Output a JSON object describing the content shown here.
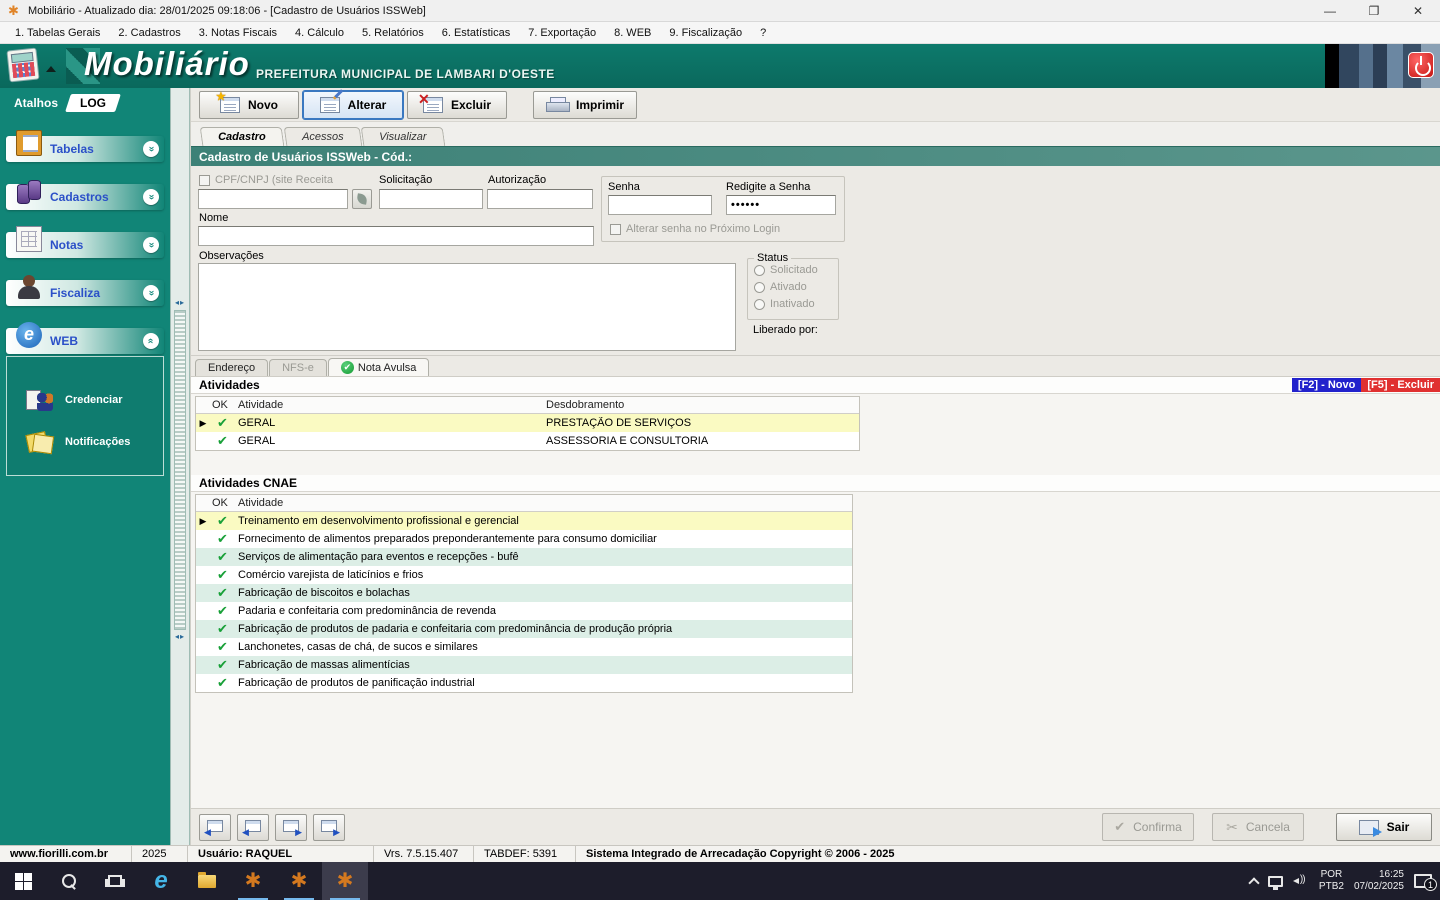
{
  "window": {
    "title": "Mobiliário - Atualizado dia: 28/01/2025 09:18:06 - [Cadastro de Usuários ISSWeb]",
    "menu": [
      "1. Tabelas Gerais",
      "2. Cadastros",
      "3. Notas Fiscais",
      "4. Cálculo",
      "5. Relatórios",
      "6. Estatísticas",
      "7. Exportação",
      "8. WEB",
      "9. Fiscalização",
      "?"
    ]
  },
  "header": {
    "logo": "Mobiliário",
    "subtitle": "PREFEITURA MUNICIPAL DE LAMBARI D'OESTE"
  },
  "sidebar": {
    "shortcuts_label": "Atalhos",
    "log_label": "LOG",
    "groups": [
      {
        "label": "Tabelas"
      },
      {
        "label": "Cadastros"
      },
      {
        "label": "Notas"
      },
      {
        "label": "Fiscaliza"
      },
      {
        "label": "WEB"
      }
    ],
    "web_items": [
      {
        "label": "Credenciar"
      },
      {
        "label": "Notificações"
      }
    ]
  },
  "toolbar": {
    "novo": "Novo",
    "alterar": "Alterar",
    "excluir": "Excluir",
    "imprimir": "Imprimir"
  },
  "tabs": [
    "Cadastro",
    "Acessos",
    "Visualizar"
  ],
  "form": {
    "section_title": "Cadastro de Usuários ISSWeb - Cód.:",
    "cpf_label": "CPF/CNPJ (site Receita",
    "solicitacao_label": "Solicitação",
    "autorizacao_label": "Autorização",
    "senha_label": "Senha",
    "redigite_label": "Redigite a Senha",
    "senha_value": "••••••",
    "alterar_senha_label": "Alterar senha no Próximo Login",
    "nome_label": "Nome",
    "observacoes_label": "Observações",
    "status_label": "Status",
    "status_options": [
      "Solicitado",
      "Ativado",
      "Inativado"
    ],
    "liberado_label": "Liberado por:"
  },
  "subtabs": [
    "Endereço",
    "NFS-e",
    "Nota Avulsa"
  ],
  "atividades": {
    "title": "Atividades",
    "f2_label": "[F2] - Novo",
    "f5_label": "[F5] - Excluir",
    "columns": [
      "OK",
      "Atividade",
      "Desdobramento"
    ],
    "rows": [
      {
        "atividade": "GERAL",
        "desdobramento": "PRESTAÇÃO DE SERVIÇOS"
      },
      {
        "atividade": "GERAL",
        "desdobramento": "ASSESSORIA E CONSULTORIA"
      }
    ]
  },
  "atividades_cnae": {
    "title": "Atividades CNAE",
    "columns": [
      "OK",
      "Atividade"
    ],
    "rows": [
      "Treinamento em desenvolvimento profissional e gerencial",
      "Fornecimento de alimentos preparados preponderantemente para consumo domiciliar",
      "Serviços de alimentação para eventos e recepções - bufê",
      "Comércio varejista de laticínios e frios",
      "Fabricação de biscoitos e bolachas",
      "Padaria e confeitaria com predominância de revenda",
      "Fabricação de produtos de padaria e confeitaria com predominância de produção própria",
      "Lanchonetes, casas de chá, de sucos e similares",
      "Fabricação de massas alimentícias",
      "Fabricação de produtos de panificação industrial"
    ]
  },
  "footer": {
    "confirma": "Confirma",
    "cancela": "Cancela",
    "sair": "Sair"
  },
  "statusbar": {
    "site": "www.fiorilli.com.br",
    "year": "2025",
    "user": "Usuário: RAQUEL",
    "version": "Vrs. 7.5.15.407",
    "tabdef": "TABDEF: 5391",
    "copyright": "Sistema Integrado de Arrecadação Copyright © 2006 - 2025"
  },
  "taskbar": {
    "lang_top": "POR",
    "lang_bottom": "PTB2",
    "time": "16:25",
    "date": "07/02/2025",
    "notif_count": "1"
  },
  "icons": {
    "app": "✱",
    "minimize": "—",
    "maximize": "❐",
    "close": "✕",
    "check": "✔",
    "arrow": "▶",
    "star": "★",
    "x": "✕",
    "scissors": "✂",
    "chevron": "»",
    "web_e": "e"
  }
}
